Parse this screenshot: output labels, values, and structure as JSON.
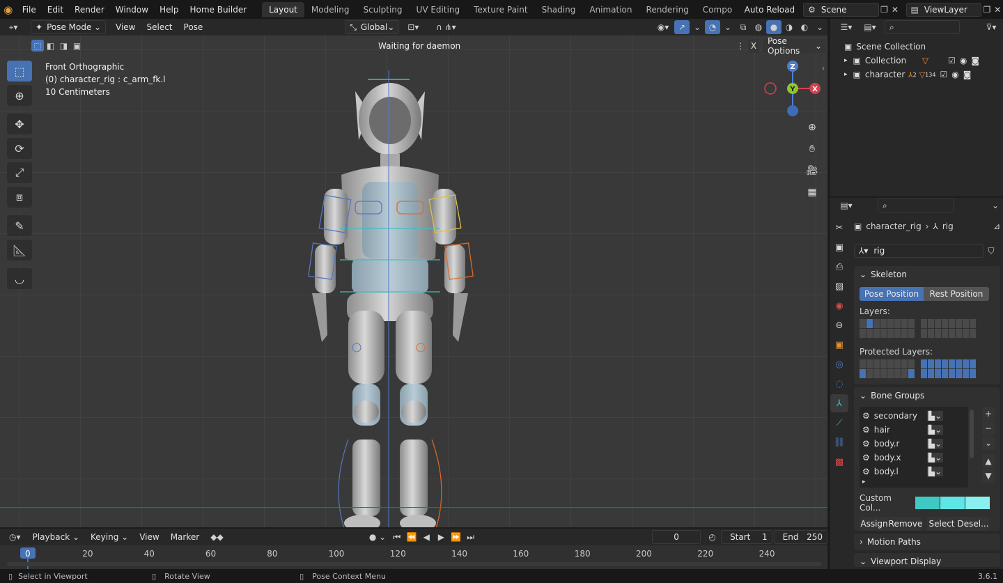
{
  "menu": [
    "File",
    "Edit",
    "Render",
    "Window",
    "Help",
    "Home Builder"
  ],
  "workspaces": [
    "Layout",
    "Modeling",
    "Sculpting",
    "UV Editing",
    "Texture Paint",
    "Shading",
    "Animation",
    "Rendering",
    "Compositir"
  ],
  "active_workspace": "Layout",
  "auto_reload": "Auto Reload",
  "scene": "Scene",
  "view_layer": "ViewLayer",
  "viewport_header": {
    "mode": "Pose Mode",
    "menus": [
      "View",
      "Select",
      "Pose"
    ],
    "orientation": "Global",
    "status_text": "Waiting for daemon",
    "pose_options": "Pose Options",
    "x_label": "X"
  },
  "overlay": {
    "view_name": "Front Orthographic",
    "object": "(0) character_rig : c_arm_fk.l",
    "scale": "10 Centimeters"
  },
  "gizmo": {
    "z": "Z",
    "y": "Y",
    "x": "X"
  },
  "outliner": {
    "root": "Scene Collection",
    "items": [
      {
        "name": "Collection"
      },
      {
        "name": "character",
        "badges": [
          "2",
          "134"
        ]
      }
    ]
  },
  "properties": {
    "breadcrumb_object": "character_rig",
    "breadcrumb_data": "rig",
    "data_name": "rig",
    "skeleton": {
      "title": "Skeleton",
      "pose_position": "Pose Position",
      "rest_position": "Rest Position",
      "layers_label": "Layers:",
      "protected_label": "Protected Layers:"
    },
    "bone_groups": {
      "title": "Bone Groups",
      "items": [
        "secondary",
        "hair",
        "body.r",
        "body.x",
        "body.l"
      ],
      "custom_color": "Custom Col...",
      "assign": "Assign",
      "remove": "Remove",
      "select": "Select",
      "deselect": "Desel..."
    },
    "motion_paths": "Motion Paths",
    "viewport_display": "Viewport Display"
  },
  "timeline": {
    "menus": [
      "Playback",
      "Keying",
      "View",
      "Marker"
    ],
    "current_frame": "0",
    "start_label": "Start",
    "start": "1",
    "end_label": "End",
    "end": "250",
    "ticks": [
      "0",
      "20",
      "40",
      "60",
      "80",
      "100",
      "120",
      "140",
      "160",
      "180",
      "200",
      "220",
      "240"
    ]
  },
  "statusbar": {
    "select": "Select in Viewport",
    "rotate": "Rotate View",
    "context": "Pose Context Menu",
    "version": "3.6.1"
  },
  "colors": {
    "accent": "#4772b3",
    "custom_color_1": "#3ec9c3",
    "custom_color_2": "#5ee6e6",
    "custom_color_3": "#8af0ef",
    "x_axis": "#d4424f",
    "y_axis": "#8ac926",
    "z_axis": "#4a7fd4"
  }
}
